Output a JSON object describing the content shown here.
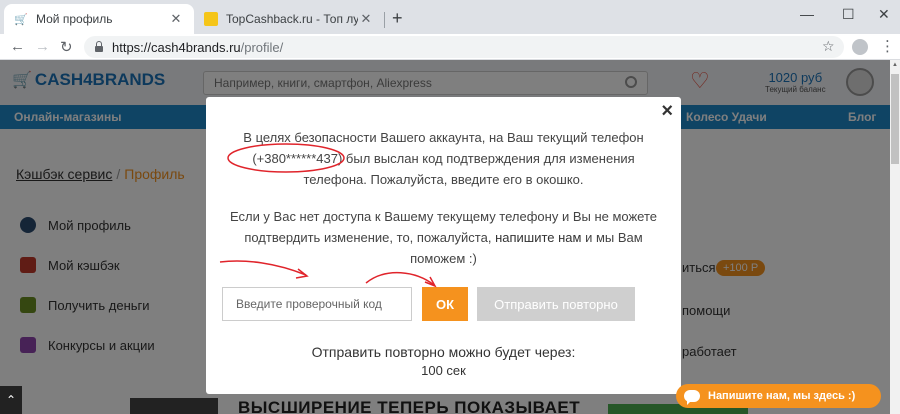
{
  "browser": {
    "tabs": [
      {
        "label": "Мой профиль",
        "active": true
      },
      {
        "label": "TopCashback.ru - Топ лучших к",
        "active": false
      }
    ],
    "new_tab": "+",
    "window_controls": {
      "minimize": "—",
      "maximize": "☐",
      "close": "✕"
    },
    "nav": {
      "back": "←",
      "forward": "→",
      "reload": "↻"
    },
    "url": {
      "host": "https://cash4brands.ru",
      "path": "/profile/"
    },
    "bookmark": "☆",
    "menu": "⋮"
  },
  "site": {
    "logo": "CASH4BRANDS",
    "search_placeholder": "Например, книги, смартфон, Aliexpress",
    "balance": {
      "amount": "1020 руб",
      "caption": "Текущий баланс"
    },
    "nav": {
      "left": "Онлайн-магазины",
      "wheel": "Колесо Удачи",
      "blog": "Блог"
    },
    "breadcrumb": {
      "root": "Кэшбэк сервис",
      "separator": "/",
      "current": "Профиль"
    },
    "sidebar": [
      {
        "label": "Мой профиль",
        "icon": "profile-icon",
        "color": "#2b4a6f"
      },
      {
        "label": "Мой кэшбэк",
        "icon": "cashback-icon",
        "color": "#c0392b"
      },
      {
        "label": "Получить деньги",
        "icon": "money-icon",
        "color": "#6b8e23"
      },
      {
        "label": "Конкурсы и акции",
        "icon": "party-icon",
        "color": "#8e44ad"
      }
    ],
    "right_fragments": {
      "r1": "иться",
      "badge": "+100 Р",
      "r2": "помощи",
      "r3": "работает"
    },
    "banner": "ВЫСШИРЕНИЕ ТЕПЕРЬ ПОКАЗЫВАЕТ"
  },
  "modal": {
    "close": "×",
    "message_line1": "В целях безопасности Вашего аккаунта, на Ваш текущий телефон",
    "phone": "(+380******437)",
    "message_line2": " был выслан код подтверждения для изменения телефона. Пожалуйста, введите его в окошко.",
    "help_text": "Если у Вас нет доступа к Вашему текущему телефону и Вы не можете подтвердить изменение, то, пожалуйста, ",
    "help_link": "напишите нам",
    "help_tail": " и мы Вам поможем :)",
    "code_placeholder": "Введите проверочный код",
    "ok_label": "ОК",
    "resend_label": "Отправить повторно",
    "timer_label": "Отправить повторно можно будет через:",
    "timer_value": "100 сек"
  },
  "chat_widget": {
    "label": "Напишите нам, мы здесь :)"
  },
  "colors": {
    "accent": "#f5921e",
    "brand": "#1e88c9",
    "annotation": "#e0242b"
  }
}
